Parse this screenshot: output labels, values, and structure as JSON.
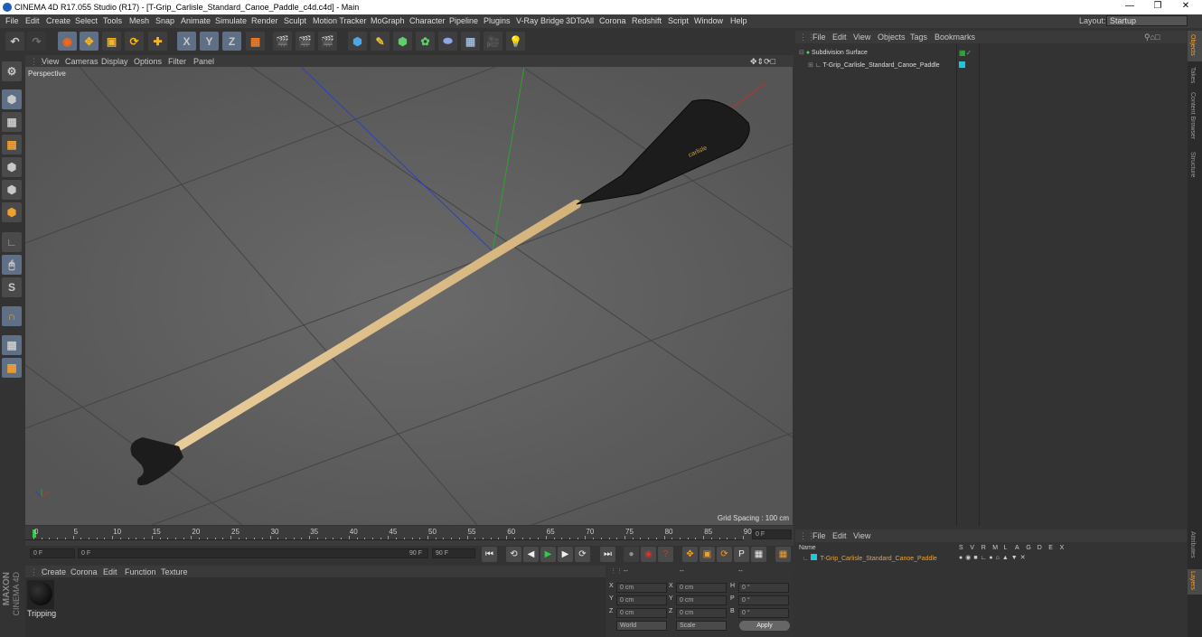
{
  "window": {
    "title": "CINEMA 4D R17.055 Studio (R17) - [T-Grip_Carlisle_Standard_Canoe_Paddle_c4d.c4d] - Main"
  },
  "menu": [
    "File",
    "Edit",
    "Create",
    "Select",
    "Tools",
    "Mesh",
    "Snap",
    "Animate",
    "Simulate",
    "Render",
    "Sculpt",
    "Motion Tracker",
    "MoGraph",
    "Character",
    "Pipeline",
    "Plugins",
    "V-Ray Bridge",
    "3DToAll",
    "Corona",
    "Redshift",
    "Script",
    "Window",
    "Help"
  ],
  "layout": {
    "label": "Layout:",
    "value": "Startup"
  },
  "toolbar": {
    "x": "X",
    "y": "Y",
    "z": "Z"
  },
  "viewport": {
    "menu": [
      "View",
      "Cameras",
      "Display",
      "Options",
      "Filter",
      "Panel"
    ],
    "label": "Perspective",
    "grid_spacing": "Grid Spacing : 100 cm"
  },
  "timeline": {
    "ticks": [
      "0",
      "5",
      "10",
      "15",
      "20",
      "25",
      "30",
      "35",
      "40",
      "45",
      "50",
      "55",
      "60",
      "65",
      "70",
      "75",
      "80",
      "85",
      "90"
    ],
    "end_frame": "0 F"
  },
  "controls": {
    "start": "0 F",
    "range_start": "0 F",
    "range_end": "90 F",
    "end": "90 F"
  },
  "material": {
    "menu": [
      "Create",
      "Corona",
      "Edit",
      "Function",
      "Texture"
    ],
    "name": "Tripping"
  },
  "coords": {
    "header": [
      "--",
      "--",
      "--"
    ],
    "rows": [
      {
        "a": "X",
        "av": "0 cm",
        "b": "X",
        "bv": "0 cm",
        "c": "H",
        "cv": "0 °"
      },
      {
        "a": "Y",
        "av": "0 cm",
        "b": "Y",
        "bv": "0 cm",
        "c": "P",
        "cv": "0 °"
      },
      {
        "a": "Z",
        "av": "0 cm",
        "b": "Z",
        "bv": "0 cm",
        "c": "B",
        "cv": "0 °"
      }
    ],
    "world": "World",
    "scale": "Scale",
    "apply": "Apply"
  },
  "objects": {
    "menu": [
      "File",
      "Edit",
      "View",
      "Objects",
      "Tags",
      "Bookmarks"
    ],
    "items": [
      "Subdivision Surface",
      "T-Grip_Carlisle_Standard_Canoe_Paddle"
    ]
  },
  "layers": {
    "menu": [
      "File",
      "Edit",
      "View"
    ],
    "name_header": "Name",
    "cols": [
      "S",
      "V",
      "R",
      "M",
      "L",
      "A",
      "G",
      "D",
      "E",
      "X"
    ],
    "item": "T-Grip_Carlisle_Standard_Canoe_Paddle"
  },
  "right_tabs": [
    "Objects",
    "Takes",
    "Content Browser",
    "Structure",
    "Attributes",
    "Layers"
  ],
  "brand": {
    "maxon": "MAXON",
    "cinema": "CINEMA 4D"
  },
  "colors": {
    "accent": "#5e6f86",
    "layer_cyan": "#1ec8d8",
    "active_text": "#e8a23a"
  }
}
